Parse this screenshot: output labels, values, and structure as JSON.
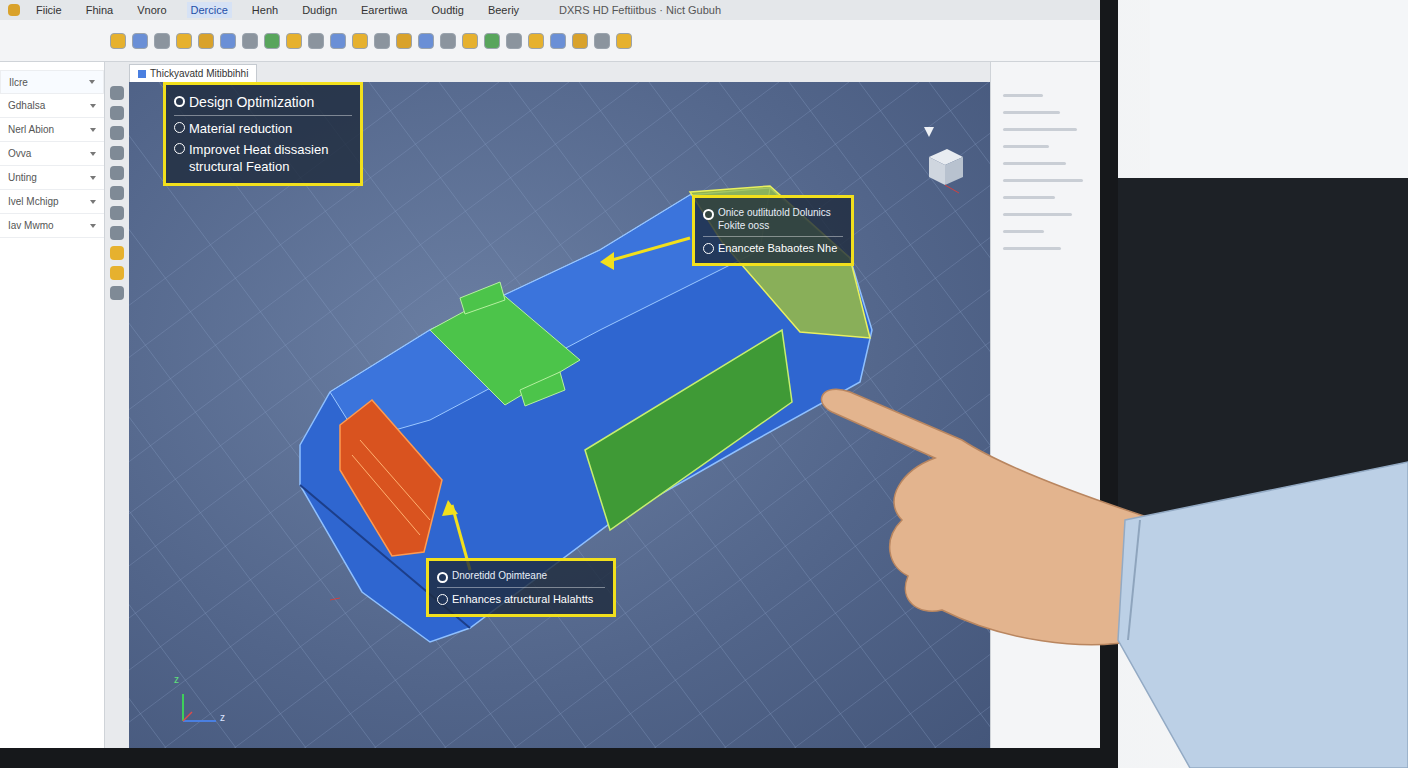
{
  "window": {
    "title": "DXRS HD Feftiitbus · Nict Gubuh"
  },
  "menu": [
    {
      "label": "Fiicie",
      "selected": false
    },
    {
      "label": "Fhina",
      "selected": false
    },
    {
      "label": "Vnoro",
      "selected": false
    },
    {
      "label": "Dercice",
      "selected": true
    },
    {
      "label": "Henh",
      "selected": false
    },
    {
      "label": "Dudign",
      "selected": false
    },
    {
      "label": "Earertiwa",
      "selected": false
    },
    {
      "label": "Oudtig",
      "selected": false
    },
    {
      "label": "Beeriy",
      "selected": false
    }
  ],
  "document_tab": {
    "label": "Thickyavatd Mitibbihhi",
    "selected": true
  },
  "sidebar": {
    "items": [
      {
        "label": "Ilcre",
        "selected": true
      },
      {
        "label": "Gdhalsa",
        "selected": false
      },
      {
        "label": "Nerl Abion",
        "selected": false
      },
      {
        "label": "Ovva",
        "selected": false
      },
      {
        "label": "Unting",
        "selected": false
      },
      {
        "label": "Ivel Mchigp",
        "selected": false
      },
      {
        "label": "Iav Mwmo",
        "selected": false
      }
    ]
  },
  "callouts": [
    {
      "title": "Design Optimization",
      "items": [
        "Material reduction",
        "Improvet Heat dissasien structural Feation"
      ]
    },
    {
      "title": "Onice outlitutold Dolunics Fokite ooss",
      "items": [
        "Enancete Babaotes Nhe"
      ]
    },
    {
      "title": "Dnoretidd Opimteane",
      "items": [
        "Enhances atructural Halahtts"
      ]
    }
  ],
  "axes": [
    "z",
    "z"
  ]
}
